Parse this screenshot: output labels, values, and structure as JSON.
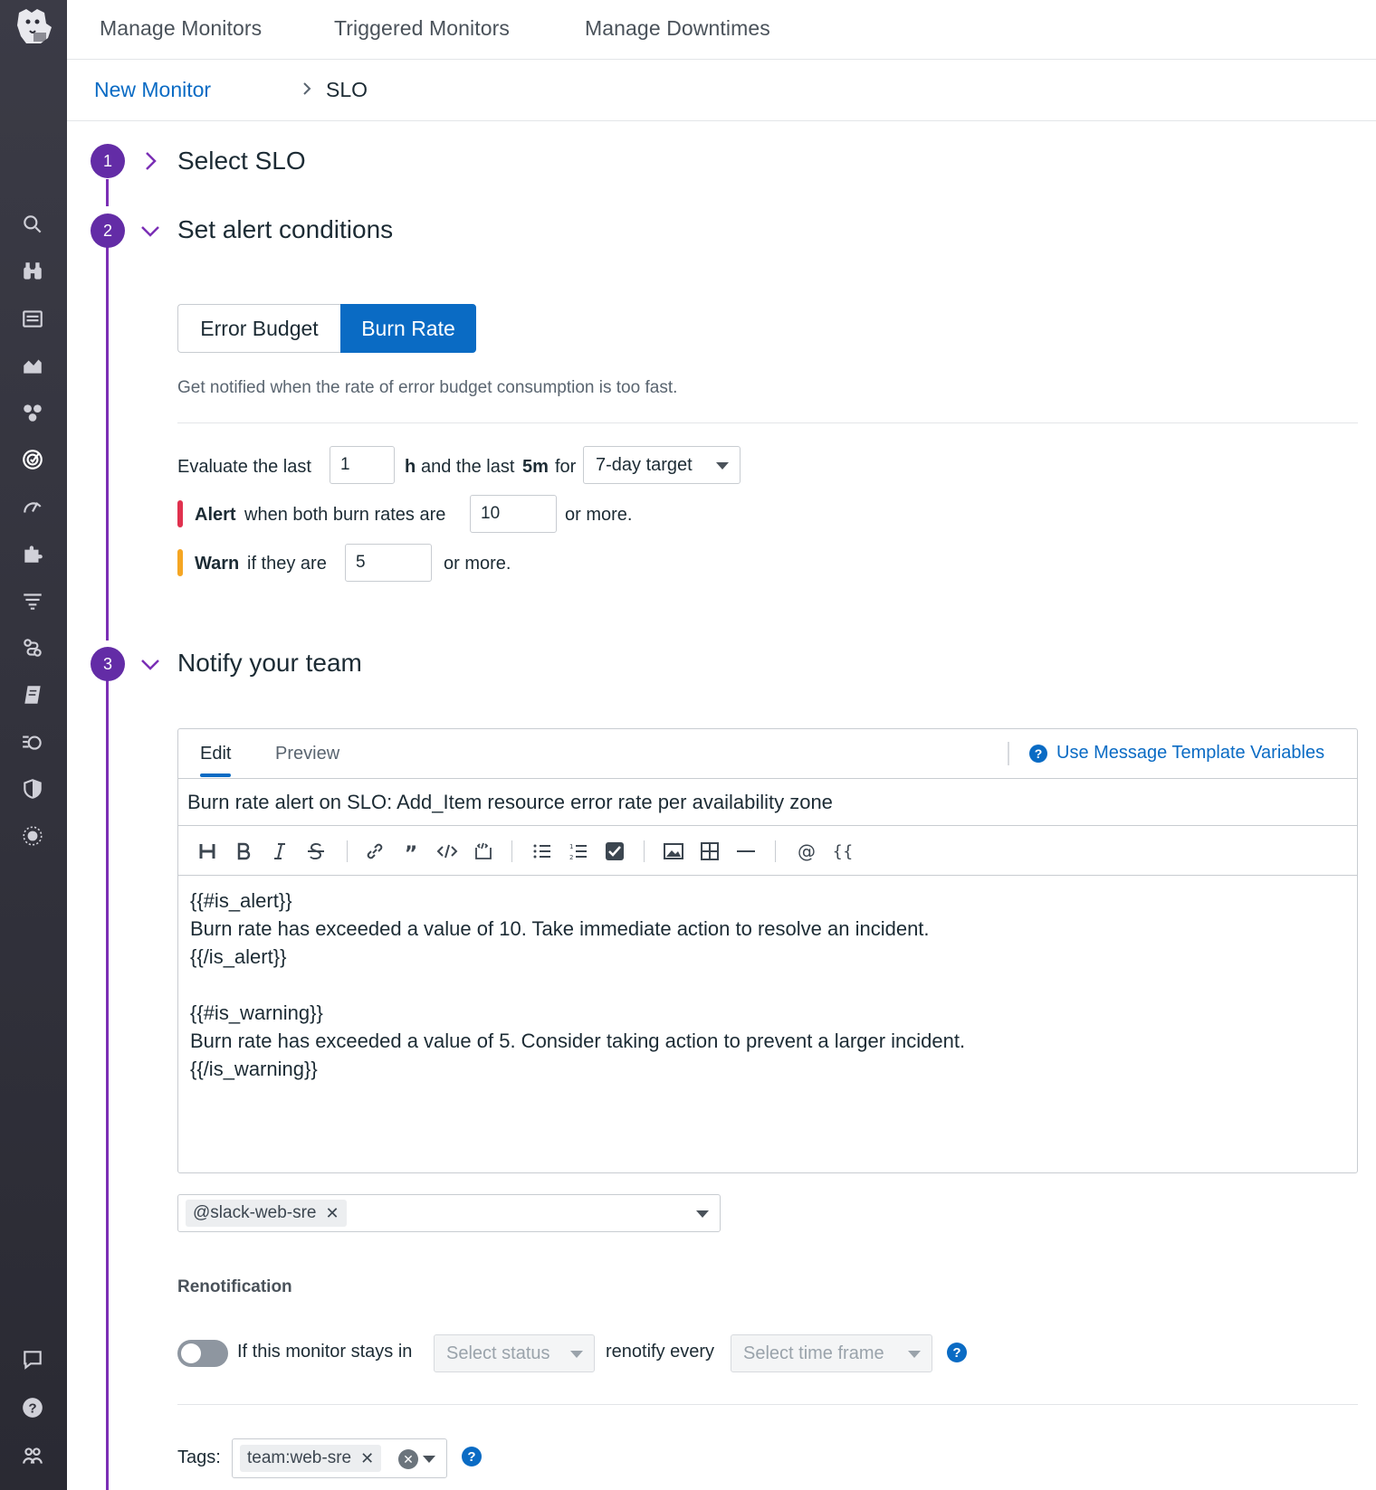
{
  "topnav": {
    "tabs": [
      "Manage Monitors",
      "Triggered Monitors",
      "Manage Downtimes"
    ]
  },
  "breadcrumb": {
    "parent": "New Monitor",
    "current": "SLO"
  },
  "steps": [
    {
      "number": "1",
      "title": "Select SLO"
    },
    {
      "number": "2",
      "title": "Set alert conditions"
    },
    {
      "number": "3",
      "title": "Notify your team"
    }
  ],
  "alert_conditions": {
    "mode_options": [
      "Error Budget",
      "Burn Rate"
    ],
    "selected_mode": "Burn Rate",
    "description": "Get notified when the rate of error budget consumption is too fast.",
    "evaluate_label": "Evaluate the last",
    "long_window_value": "1",
    "long_window_unit": "h",
    "short_window_text_a": "and the last",
    "short_window_value": "5m",
    "short_window_text_b": "for",
    "target_select": "7-day target",
    "alert_keyword": "Alert",
    "alert_text": "when both burn rates are",
    "alert_threshold": "10",
    "alert_suffix": "or more.",
    "warn_keyword": "Warn",
    "warn_text": "if they are",
    "warn_threshold": "5",
    "warn_suffix": "or more.",
    "alert_color": "#e0314e",
    "warn_color": "#f5a623"
  },
  "notify": {
    "editor_tabs": [
      "Edit",
      "Preview"
    ],
    "template_link": "Use Message Template Variables",
    "subject": "Burn rate alert on SLO: Add_Item resource error rate per availability zone",
    "toolbar_icons": [
      "heading-icon",
      "bold-icon",
      "italic-icon",
      "strikethrough-icon",
      "link-icon",
      "quote-icon",
      "code-icon",
      "code-block-icon",
      "bullet-list-icon",
      "numbered-list-icon",
      "checkbox-icon",
      "image-icon",
      "table-icon",
      "horizontal-rule-icon",
      "mention-icon",
      "variable-icon"
    ],
    "body_lines": [
      "{{#is_alert}}",
      "Burn rate has exceeded a value of 10. Take immediate action to resolve an incident.",
      "{{/is_alert}}",
      "",
      "{{#is_warning}}",
      "Burn rate has exceeded a value of 5. Consider taking action to prevent a larger incident.",
      "{{/is_warning}}"
    ],
    "recipients": [
      "@slack-web-sre"
    ]
  },
  "renotification": {
    "heading": "Renotification",
    "toggle_on": false,
    "text_a": "If this monitor stays in",
    "status_placeholder": "Select status",
    "text_b": "renotify every",
    "timeframe_placeholder": "Select time frame"
  },
  "tags": {
    "label": "Tags:",
    "values": [
      "team:web-sre"
    ]
  },
  "colors": {
    "accent": "#0a6bc4",
    "step": "#632ca6",
    "sidebar": "#2f2f39"
  },
  "sidebar_icons": [
    "search-icon",
    "binoculars-icon",
    "list-icon",
    "chart-icon",
    "integrations-icon",
    "slo-target-icon",
    "apm-icon",
    "puzzle-icon",
    "logs-icon",
    "synthetics-icon",
    "notebook-icon",
    "watchdog-icon",
    "security-icon",
    "rum-icon",
    "chat-icon",
    "help-icon",
    "team-icon"
  ]
}
